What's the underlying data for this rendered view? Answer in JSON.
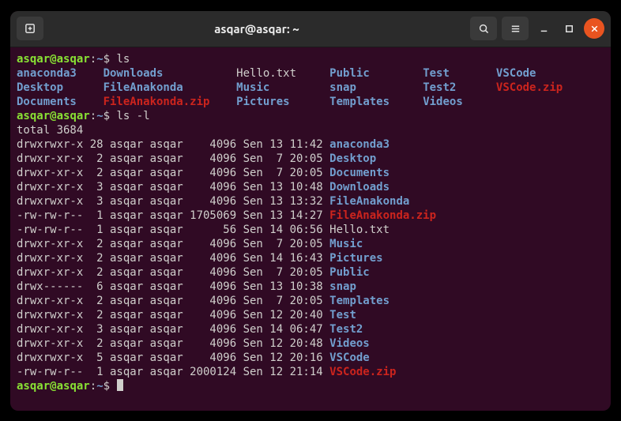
{
  "titlebar": {
    "title": "asqar@asqar: ~"
  },
  "prompt": {
    "user": "asqar",
    "host": "asqar",
    "path": "~",
    "sep": "@",
    "colon": ":",
    "dollar": "$"
  },
  "commands": {
    "c1": "ls",
    "c2": "ls -l",
    "c3": ""
  },
  "ls_cols": [
    [
      {
        "name": "anaconda3",
        "cls": "dir"
      },
      {
        "name": "Desktop",
        "cls": "dir"
      },
      {
        "name": "Documents",
        "cls": "dir"
      }
    ],
    [
      {
        "name": "Downloads",
        "cls": "dir"
      },
      {
        "name": "FileAnakonda",
        "cls": "dir"
      },
      {
        "name": "FileAnakonda.zip",
        "cls": "zip"
      }
    ],
    [
      {
        "name": "Hello.txt",
        "cls": "plain"
      },
      {
        "name": "Music",
        "cls": "dir"
      },
      {
        "name": "Pictures",
        "cls": "dir"
      }
    ],
    [
      {
        "name": "Public",
        "cls": "dir"
      },
      {
        "name": "snap",
        "cls": "dir"
      },
      {
        "name": "Templates",
        "cls": "dir"
      }
    ],
    [
      {
        "name": "Test",
        "cls": "dir"
      },
      {
        "name": "Test2",
        "cls": "dir"
      },
      {
        "name": "Videos",
        "cls": "dir"
      }
    ],
    [
      {
        "name": "VSCode",
        "cls": "dir"
      },
      {
        "name": "VSCode.zip",
        "cls": "zip"
      }
    ]
  ],
  "ls_col_widths": [
    11,
    18,
    12,
    12,
    9
  ],
  "lsl": {
    "total": "total 3684",
    "rows": [
      {
        "perm": "drwxrwxr-x",
        "links": "28",
        "owner": "asqar",
        "group": "asqar",
        "size": "4096",
        "date": "Sen 13 11:42",
        "name": "anaconda3",
        "cls": "dir"
      },
      {
        "perm": "drwxr-xr-x",
        "links": "2",
        "owner": "asqar",
        "group": "asqar",
        "size": "4096",
        "date": "Sen  7 20:05",
        "name": "Desktop",
        "cls": "dir"
      },
      {
        "perm": "drwxr-xr-x",
        "links": "2",
        "owner": "asqar",
        "group": "asqar",
        "size": "4096",
        "date": "Sen  7 20:05",
        "name": "Documents",
        "cls": "dir"
      },
      {
        "perm": "drwxr-xr-x",
        "links": "3",
        "owner": "asqar",
        "group": "asqar",
        "size": "4096",
        "date": "Sen 13 10:48",
        "name": "Downloads",
        "cls": "dir"
      },
      {
        "perm": "drwxrwxr-x",
        "links": "3",
        "owner": "asqar",
        "group": "asqar",
        "size": "4096",
        "date": "Sen 13 13:32",
        "name": "FileAnakonda",
        "cls": "dir"
      },
      {
        "perm": "-rw-rw-r--",
        "links": "1",
        "owner": "asqar",
        "group": "asqar",
        "size": "1705069",
        "date": "Sen 13 14:27",
        "name": "FileAnakonda.zip",
        "cls": "zip"
      },
      {
        "perm": "-rw-rw-r--",
        "links": "1",
        "owner": "asqar",
        "group": "asqar",
        "size": "56",
        "date": "Sen 14 06:56",
        "name": "Hello.txt",
        "cls": "plain"
      },
      {
        "perm": "drwxr-xr-x",
        "links": "2",
        "owner": "asqar",
        "group": "asqar",
        "size": "4096",
        "date": "Sen  7 20:05",
        "name": "Music",
        "cls": "dir"
      },
      {
        "perm": "drwxr-xr-x",
        "links": "2",
        "owner": "asqar",
        "group": "asqar",
        "size": "4096",
        "date": "Sen 14 16:43",
        "name": "Pictures",
        "cls": "dir"
      },
      {
        "perm": "drwxr-xr-x",
        "links": "2",
        "owner": "asqar",
        "group": "asqar",
        "size": "4096",
        "date": "Sen  7 20:05",
        "name": "Public",
        "cls": "dir"
      },
      {
        "perm": "drwx------",
        "links": "6",
        "owner": "asqar",
        "group": "asqar",
        "size": "4096",
        "date": "Sen 13 10:38",
        "name": "snap",
        "cls": "dir"
      },
      {
        "perm": "drwxr-xr-x",
        "links": "2",
        "owner": "asqar",
        "group": "asqar",
        "size": "4096",
        "date": "Sen  7 20:05",
        "name": "Templates",
        "cls": "dir"
      },
      {
        "perm": "drwxrwxr-x",
        "links": "2",
        "owner": "asqar",
        "group": "asqar",
        "size": "4096",
        "date": "Sen 12 20:40",
        "name": "Test",
        "cls": "dir"
      },
      {
        "perm": "drwxr-xr-x",
        "links": "3",
        "owner": "asqar",
        "group": "asqar",
        "size": "4096",
        "date": "Sen 14 06:47",
        "name": "Test2",
        "cls": "dir"
      },
      {
        "perm": "drwxr-xr-x",
        "links": "2",
        "owner": "asqar",
        "group": "asqar",
        "size": "4096",
        "date": "Sen 12 20:48",
        "name": "Videos",
        "cls": "dir"
      },
      {
        "perm": "drwxrwxr-x",
        "links": "5",
        "owner": "asqar",
        "group": "asqar",
        "size": "4096",
        "date": "Sen 12 20:16",
        "name": "VSCode",
        "cls": "dir"
      },
      {
        "perm": "-rw-rw-r--",
        "links": "1",
        "owner": "asqar",
        "group": "asqar",
        "size": "2000124",
        "date": "Sen 12 21:14",
        "name": "VSCode.zip",
        "cls": "zip"
      }
    ]
  }
}
